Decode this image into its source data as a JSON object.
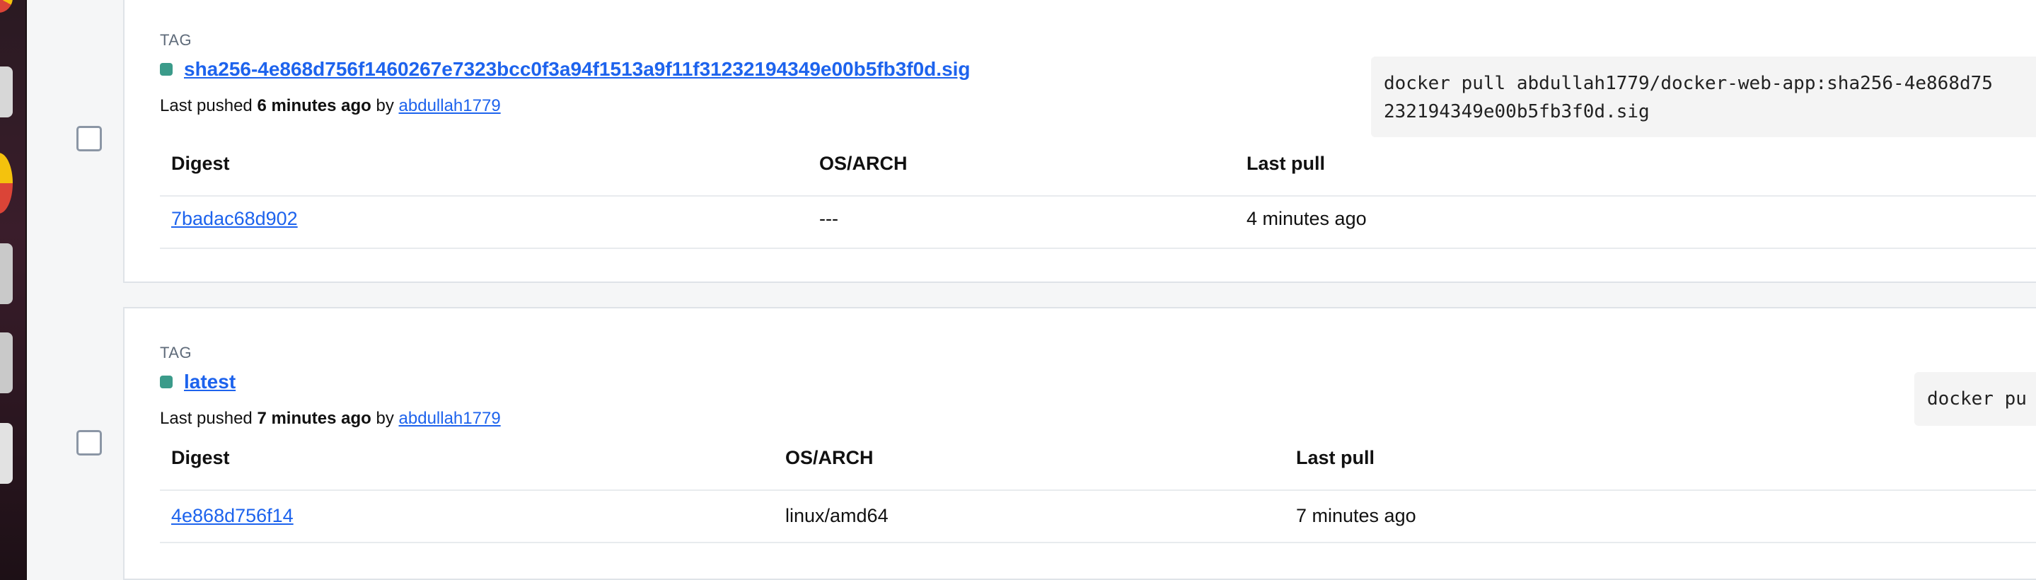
{
  "tags": [
    {
      "section_label": "TAG",
      "name": "sha256-4e868d756f1460267e7323bcc0f3a94f1513a9f11f31232194349e00b5fb3f0d.sig",
      "pushed_prefix": "Last pushed",
      "pushed_time": "6 minutes ago",
      "pushed_by_word": "by",
      "pushed_by_user": "abdullah1779",
      "pull_command_line1": "docker pull abdullah1779/docker-web-app:sha256-4e868d75",
      "pull_command_line2": "232194349e00b5fb3f0d.sig",
      "headers": {
        "digest": "Digest",
        "os_arch": "OS/ARCH",
        "last_pull": "Last pull"
      },
      "row": {
        "digest": "7badac68d902",
        "os_arch": "---",
        "last_pull": "4 minutes ago"
      }
    },
    {
      "section_label": "TAG",
      "name": "latest",
      "pushed_prefix": "Last pushed",
      "pushed_time": "7 minutes ago",
      "pushed_by_word": "by",
      "pushed_by_user": "abdullah1779",
      "pull_command_line1": "docker pu",
      "headers": {
        "digest": "Digest",
        "os_arch": "OS/ARCH",
        "last_pull": "Last pull"
      },
      "row": {
        "digest": "4e868d756f14",
        "os_arch": "linux/amd64",
        "last_pull": "7 minutes ago"
      }
    }
  ],
  "colors": {
    "accent": "#1d63ed",
    "tag_dot": "#3b9b8a",
    "checkbox_border": "#8b96a5"
  }
}
